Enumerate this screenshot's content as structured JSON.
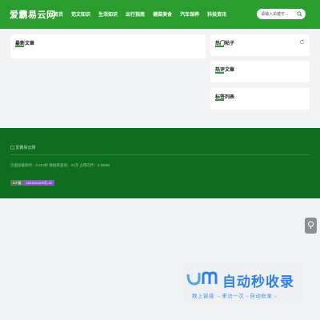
{
  "header": {
    "logo": "爱霸易云网",
    "nav": [
      "首页",
      "范文知识",
      "生活知识",
      "出行指南",
      "健菜美食",
      "汽车保养",
      "科技资讯"
    ],
    "search": {
      "placeholder": "请输入关键字..."
    }
  },
  "main": {
    "latest_title": "最新文章",
    "sidebar": {
      "hot_posts_title": "热门帖子",
      "hot_articles_title": "热评文章",
      "tags_title": "标签列表"
    }
  },
  "footer": {
    "logo_alt": "爱霸易云网",
    "stats": "页面加载耗时：0.263秒 数据库查询：21次 占用内存：5.05MB",
    "badge_label": "ICP备",
    "badge_value": "2024041525号-15"
  },
  "watermark": {
    "main": "自动秒收录",
    "sub": "数上链接 →来访一次→自动收录→"
  },
  "colors": {
    "accent": "#2b9d2e",
    "footer": "#0d6e1f",
    "badge": "#8b56c8",
    "watermark": "#2e82e4"
  }
}
